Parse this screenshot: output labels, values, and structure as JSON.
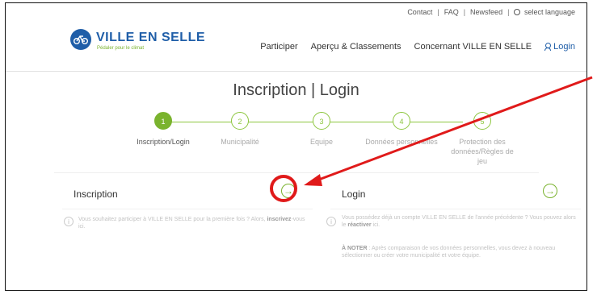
{
  "topbar": {
    "contact": "Contact",
    "faq": "FAQ",
    "newsfeed": "Newsfeed",
    "language": "select language",
    "sep": "|"
  },
  "brand": {
    "name": "VILLE EN SELLE",
    "tagline": "Pédaler pour le climat",
    "color": "#1f5ea8",
    "accent": "#7ab32e",
    "icon": "bicycle-icon"
  },
  "nav": {
    "items": [
      "Participer",
      "Aperçu & Classements",
      "Concernant VILLE EN SELLE"
    ],
    "login": "Login",
    "login_icon": "person-icon"
  },
  "page": {
    "title": "Inscription | Login"
  },
  "steps": [
    {
      "number": "1",
      "label": "Inscription/Login",
      "active": true
    },
    {
      "number": "2",
      "label": "Municipalité"
    },
    {
      "number": "3",
      "label": "Equipe"
    },
    {
      "number": "4",
      "label": "Données personnelles"
    },
    {
      "number": "5",
      "label": "Protection des données/Règles de jeu"
    }
  ],
  "inscription": {
    "title": "Inscription",
    "arrow": "→",
    "text_before": "Vous souhaitez participer à VILLE EN SELLE pour la première fois ? Alors, ",
    "text_strong": "inscrivez",
    "text_after": "-vous ici.",
    "icon": "info-icon"
  },
  "login": {
    "title": "Login",
    "arrow": "→",
    "text_before": "Vous possédez déjà un compte VILLE EN SELLE de l'année précédente ? Vous pouvez alors le ",
    "text_strong": "réactiver",
    "text_after": " ici.",
    "note_strong": "À NOTER",
    "note": " : Après comparaison de vos données personnelles, vous devez à nouveau sélectionner ou créer votre municipalité et votre équipe.",
    "icon": "info-icon"
  },
  "annotation": {
    "color": "#e01a1a"
  }
}
